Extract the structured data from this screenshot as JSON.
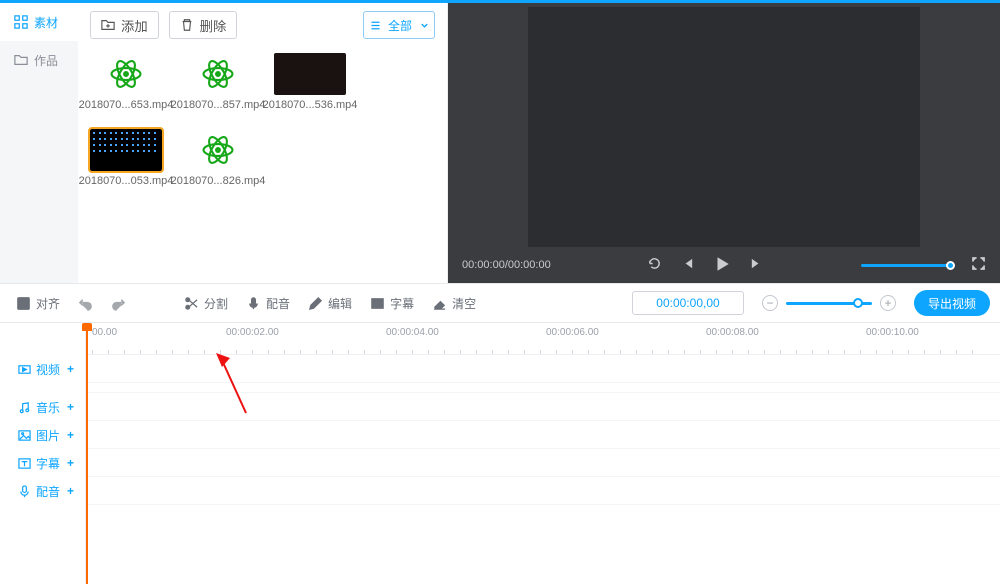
{
  "sidebar": {
    "tabs": [
      {
        "label": "素材",
        "active": true
      },
      {
        "label": "作品",
        "active": false
      }
    ]
  },
  "media_toolbar": {
    "add": "添加",
    "delete": "删除",
    "all": "全部"
  },
  "media_items": [
    {
      "name": "2018070...653.mp4",
      "kind": "atom",
      "selected": false
    },
    {
      "name": "2018070...857.mp4",
      "kind": "atom",
      "selected": false
    },
    {
      "name": "2018070...536.mp4",
      "kind": "dark",
      "selected": false
    },
    {
      "name": "2018070...053.mp4",
      "kind": "black",
      "selected": true
    },
    {
      "name": "2018070...826.mp4",
      "kind": "atom",
      "selected": false
    }
  ],
  "preview": {
    "time": "00:00:00/00:00:00"
  },
  "edit_toolbar": {
    "align": "对齐",
    "split": "分割",
    "voice": "配音",
    "edit": "编辑",
    "subtitle": "字幕",
    "clear": "清空",
    "timecode": "00:00:00,00",
    "export": "导出视频"
  },
  "ruler_ticks": [
    "00.00",
    "00:00:02.00",
    "00:00:04.00",
    "00:00:06.00",
    "00:00:08.00",
    "00:00:10.00"
  ],
  "tracks": [
    {
      "label": "视频",
      "icon": "video"
    },
    {
      "label": "音乐",
      "icon": "music"
    },
    {
      "label": "图片",
      "icon": "image"
    },
    {
      "label": "字幕",
      "icon": "text"
    },
    {
      "label": "配音",
      "icon": "mic"
    }
  ]
}
